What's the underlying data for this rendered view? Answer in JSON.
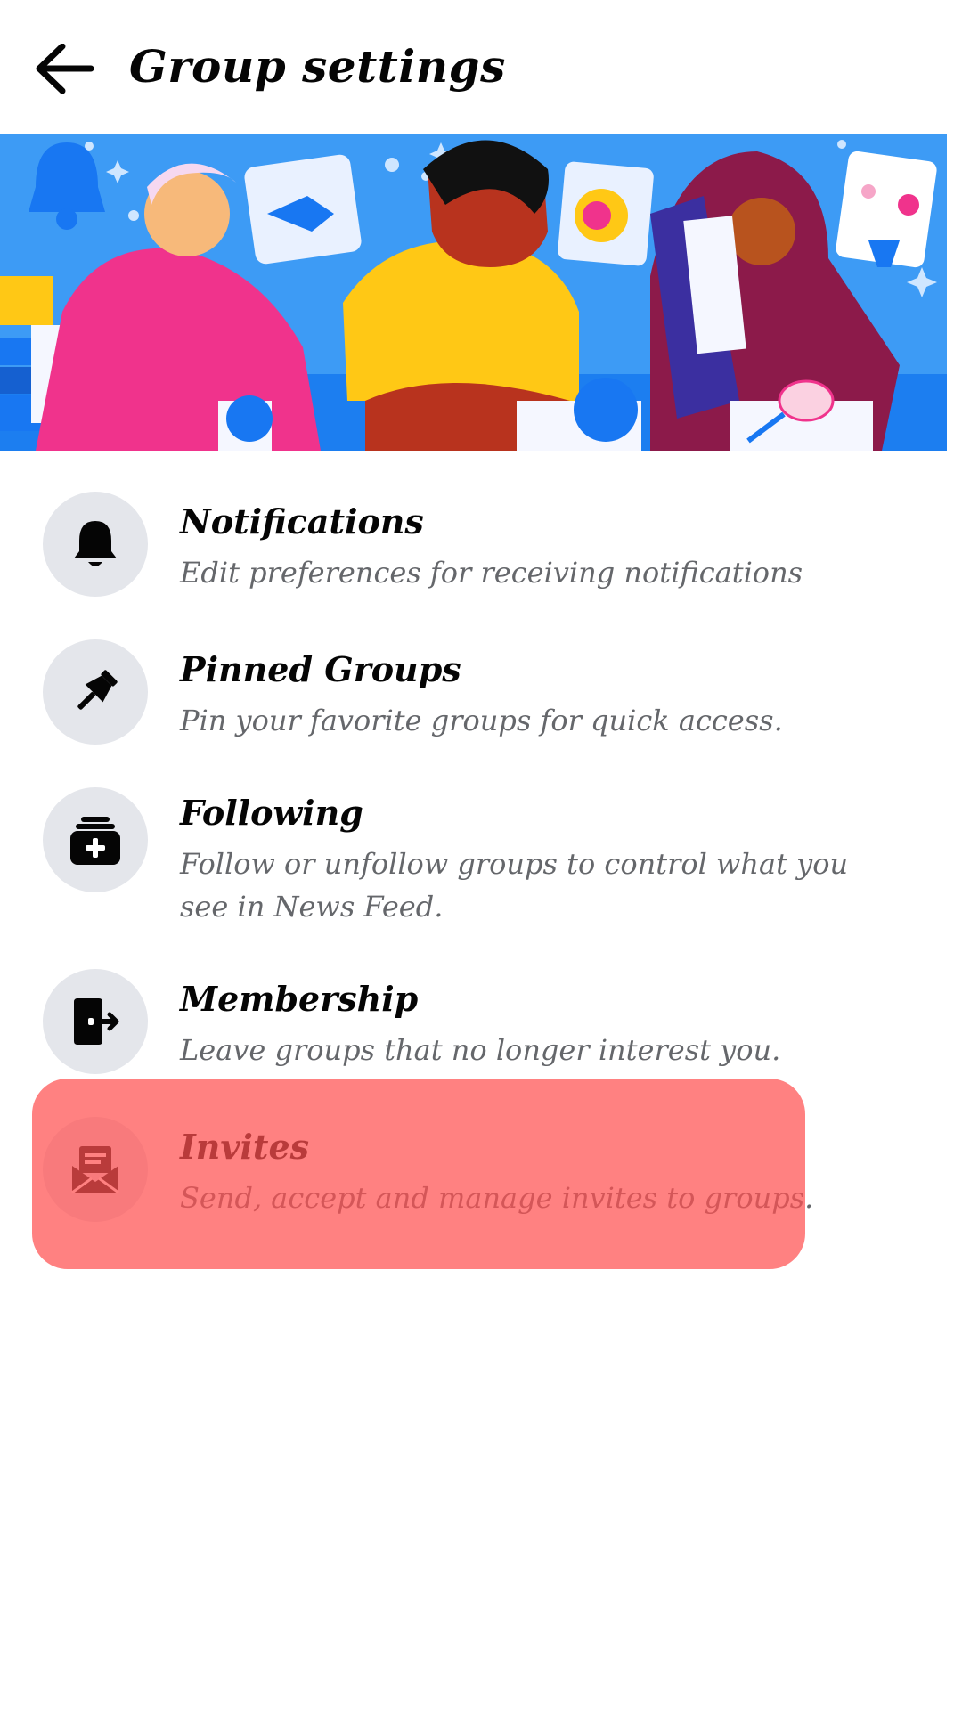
{
  "header": {
    "title": "Group settings",
    "back_icon": "arrow-left-icon"
  },
  "banner": {
    "description_icon": "group-illustration",
    "colors": {
      "sky": "#3d9bf5",
      "floor": "#1c7ef0",
      "pink": "#f0338c",
      "yellow": "#ffc815",
      "maroon": "#8c1a4a",
      "skin_dark": "#b8331e"
    }
  },
  "items": [
    {
      "title": "Notifications",
      "description": "Edit preferences for receiving notifications",
      "icon": "bell-icon"
    },
    {
      "title": "Pinned Groups",
      "description": "Pin your favorite groups for quick access.",
      "icon": "pin-icon"
    },
    {
      "title": "Following",
      "description": "Follow or unfollow groups to control what you see in News Feed.",
      "icon": "add-inbox-icon"
    },
    {
      "title": "Membership",
      "description": "Leave groups that no longer interest you.",
      "icon": "exit-door-icon"
    },
    {
      "title": "Invites",
      "description": "Send, accept and manage invites to groups.",
      "icon": "envelope-icon"
    }
  ],
  "colors": {
    "title_text": "#050505",
    "description_text": "#65676b",
    "icon_circle_bg": "#e4e6eb",
    "highlight_overlay": "#ff5050"
  }
}
